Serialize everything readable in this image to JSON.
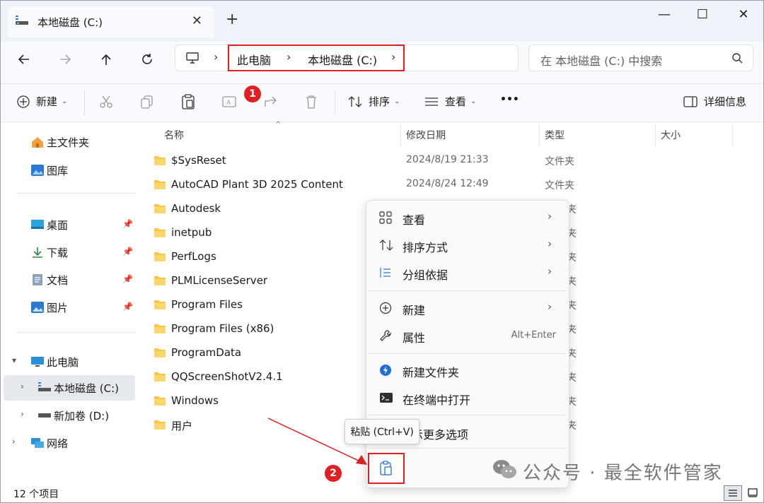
{
  "window": {
    "tab_title": "本地磁盘 (C:)",
    "tab_close": "✕",
    "new_tab": "+",
    "minimize": "—",
    "maximize": "☐",
    "close": "✕"
  },
  "address": {
    "crumbs": [
      "此电脑",
      "本地磁盘 (C:)"
    ],
    "chevron": "›",
    "search_placeholder": "在 本地磁盘 (C:) 中搜索"
  },
  "toolbar": {
    "new_label": "新建",
    "sort_label": "排序",
    "view_label": "查看",
    "more_label": "•••",
    "details_label": "详细信息",
    "dropdown": "⌄"
  },
  "badges": {
    "badge1": "1",
    "badge2": "2"
  },
  "sidebar": {
    "home": "主文件夹",
    "gallery": "图库",
    "desktop": "桌面",
    "downloads": "下载",
    "documents": "文档",
    "pictures": "图片",
    "this_pc": "此电脑",
    "local_c": "本地磁盘 (C:)",
    "new_volume_d": "新加卷 (D:)",
    "network": "网络"
  },
  "columns": {
    "name": "名称",
    "modified": "修改日期",
    "type": "类型",
    "size": "大小"
  },
  "files": [
    {
      "name": "$SysReset",
      "date": "2024/8/19 21:33",
      "type": "文件夹"
    },
    {
      "name": "AutoCAD Plant 3D 2025 Content",
      "date": "2024/8/24 12:49",
      "type": "文件夹"
    },
    {
      "name": "Autodesk",
      "date": "",
      "type": "夹"
    },
    {
      "name": "inetpub",
      "date": "",
      "type": "夹"
    },
    {
      "name": "PerfLogs",
      "date": "",
      "type": "夹"
    },
    {
      "name": "PLMLicenseServer",
      "date": "",
      "type": "夹"
    },
    {
      "name": "Program Files",
      "date": "",
      "type": "夹"
    },
    {
      "name": "Program Files (x86)",
      "date": "",
      "type": "夹"
    },
    {
      "name": "ProgramData",
      "date": "",
      "type": "夹"
    },
    {
      "name": "QQScreenShotV2.4.1",
      "date": "",
      "type": "夹"
    },
    {
      "name": "Windows",
      "date": "",
      "type": "夹"
    },
    {
      "name": "用户",
      "date": "",
      "type": "夹"
    }
  ],
  "status": {
    "count": "12 个项目"
  },
  "context_menu": {
    "view": "查看",
    "sort_by": "排序方式",
    "group_by": "分组依据",
    "new": "新建",
    "properties": "属性",
    "properties_key": "Alt+Enter",
    "new_folder": "新建文件夹",
    "open_terminal": "在终端中打开",
    "more_options": "示更多选项",
    "arrow": "›"
  },
  "tooltip": {
    "paste": "粘贴 (Ctrl+V)"
  },
  "watermark": {
    "text": "公众号 · 最全软件管家"
  },
  "colors": {
    "accent": "#0067c0",
    "folder": "#f8c74a",
    "annotation_red": "#e02020"
  }
}
